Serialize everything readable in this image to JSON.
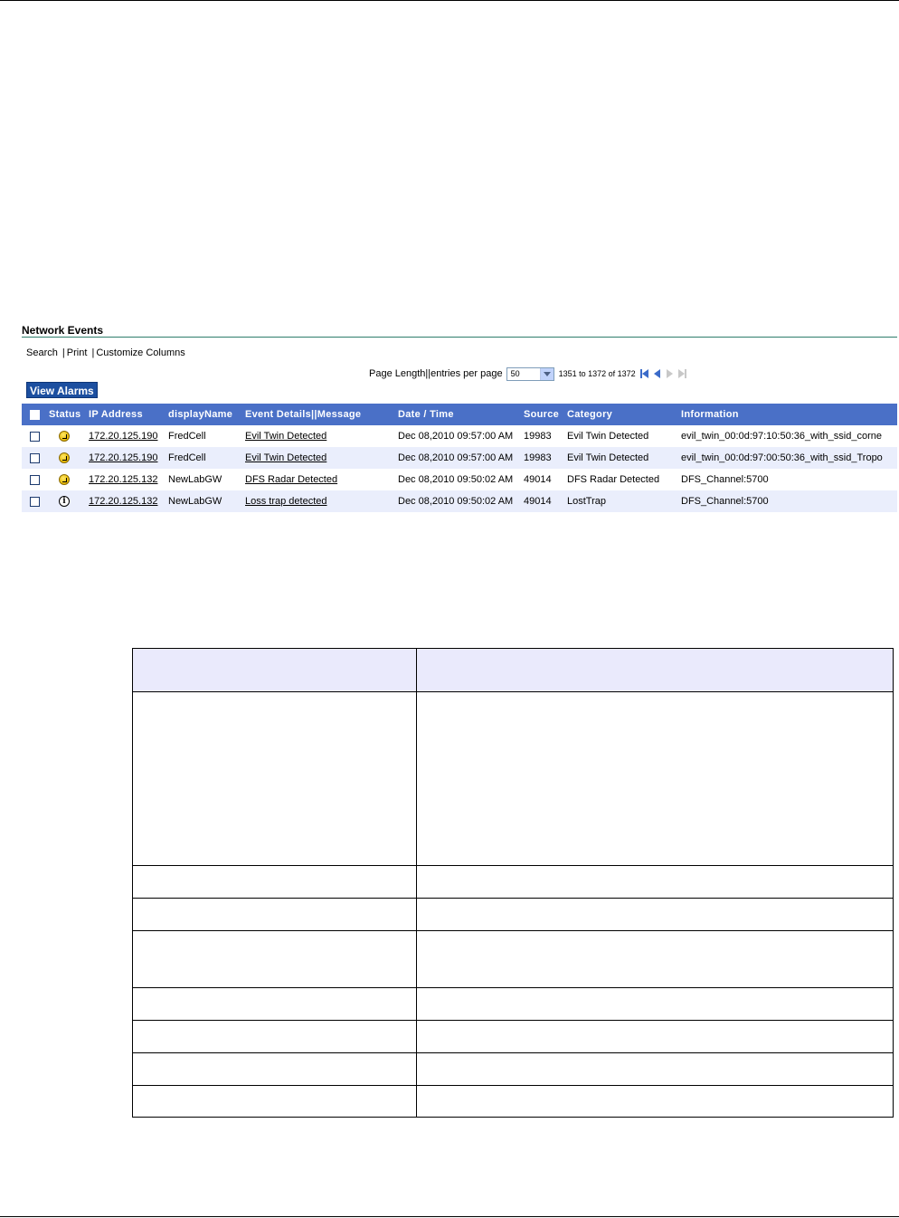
{
  "panel": {
    "title": "Network Events"
  },
  "actions": {
    "search": "Search",
    "print": "Print",
    "customize": "Customize Columns",
    "separator": "|"
  },
  "pager": {
    "label": "Page Length||entries per page",
    "page_size": "50",
    "range": "1351 to 1372 of 1372"
  },
  "view_alarms_label": "View Alarms",
  "columns": {
    "status": "Status",
    "ip": "IP Address",
    "display_name": "displayName",
    "event": "Event Details||Message",
    "datetime": "Date / Time",
    "source": "Source",
    "category": "Category",
    "information": "Information"
  },
  "rows": [
    {
      "status_icon": "warning-icon",
      "ip": "172.20.125.190",
      "display_name": "FredCell",
      "event": "Evil Twin Detected",
      "datetime": "Dec 08,2010 09:57:00 AM",
      "source": "19983",
      "category": "Evil Twin Detected",
      "information": "evil_twin_00:0d:97:10:50:36_with_ssid_corne"
    },
    {
      "status_icon": "warning-icon",
      "ip": "172.20.125.190",
      "display_name": "FredCell",
      "event": "Evil Twin Detected",
      "datetime": "Dec 08,2010 09:57:00 AM",
      "source": "19983",
      "category": "Evil Twin Detected",
      "information": "evil_twin_00:0d:97:00:50:36_with_ssid_Tropo"
    },
    {
      "status_icon": "warning-icon",
      "ip": "172.20.125.132",
      "display_name": "NewLabGW",
      "event": "DFS Radar Detected",
      "datetime": "Dec 08,2010 09:50:02 AM",
      "source": "49014",
      "category": "DFS Radar Detected",
      "information": "DFS_Channel:5700"
    },
    {
      "status_icon": "info-icon",
      "ip": "172.20.125.132",
      "display_name": "NewLabGW",
      "event": "Loss trap detected",
      "datetime": "Dec 08,2010 09:50:02 AM",
      "source": "49014",
      "category": "LostTrap",
      "information": "DFS_Channel:5700"
    }
  ],
  "colors": {
    "header_bg": "#4a70c7",
    "button_bg": "#1c4fa0",
    "alt_row_bg": "#eaeefc",
    "title_rule": "#2e7d6b"
  }
}
